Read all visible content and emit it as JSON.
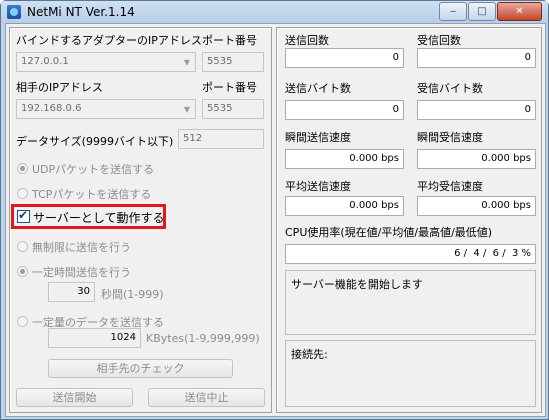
{
  "window": {
    "title": "NetMi NT Ver.1.14",
    "minimize": "‒",
    "maximize": "□",
    "close": "✕"
  },
  "left": {
    "adapter_ip_label": "バインドするアダプターのIPアドレス",
    "adapter_ip_value": "127.0.0.1",
    "port_label_1": "ポート番号",
    "port_value_1": "5535",
    "peer_ip_label": "相手のIPアドレス",
    "peer_ip_value": "192.168.0.6",
    "port_label_2": "ポート番号",
    "port_value_2": "5535",
    "data_size_label": "データサイズ(9999バイト以下)",
    "data_size_value": "512",
    "udp_label": "UDPパケットを送信する",
    "tcp_label": "TCPパケットを送信する",
    "server_label": "サーバーとして動作する",
    "unlimited_label": "無制限に送信を行う",
    "timed_label": "一定時間送信を行う",
    "timed_value": "30",
    "timed_unit": "秒間(1-999)",
    "amount_label": "一定量のデータを送信する",
    "amount_value": "1024",
    "amount_unit": "KBytes(1-9,999,999)",
    "check_peer_button": "相手先のチェック",
    "start_button": "送信開始",
    "stop_button": "送信中止"
  },
  "right": {
    "send_count_label": "送信回数",
    "send_count_value": "0",
    "recv_count_label": "受信回数",
    "recv_count_value": "0",
    "send_bytes_label": "送信バイト数",
    "send_bytes_value": "0",
    "recv_bytes_label": "受信バイト数",
    "recv_bytes_value": "0",
    "inst_send_label": "瞬間送信速度",
    "inst_send_value": "0.000 bps",
    "inst_recv_label": "瞬間受信速度",
    "inst_recv_value": "0.000 bps",
    "avg_send_label": "平均送信速度",
    "avg_send_value": "0.000 bps",
    "avg_recv_label": "平均受信速度",
    "avg_recv_value": "0.000 bps",
    "cpu_label": "CPU使用率(現在値/平均値/最高値/最低値)",
    "cpu_value": "6 /  4 /  6 /  3 %",
    "status_text": "サーバー機能を開始します",
    "connection_label": "接続先:"
  },
  "colors": {
    "highlight": "#e0181b"
  }
}
